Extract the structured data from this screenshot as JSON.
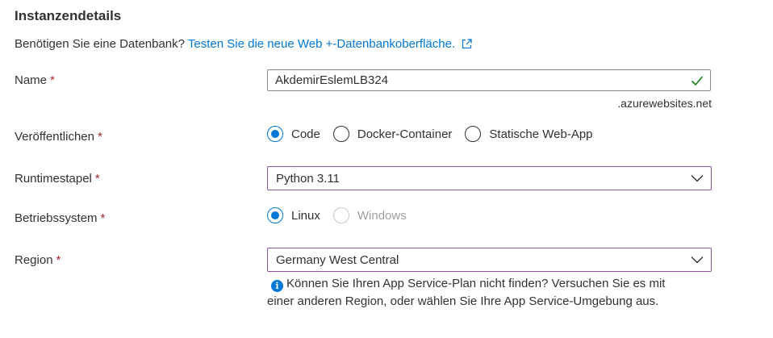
{
  "section": {
    "title": "Instanzendetails",
    "hint_text": "Benötigen Sie eine Datenbank?",
    "hint_link": "Testen Sie die neue Web +-Datenbankoberfläche.",
    "hint_link_icon": "external-link-icon"
  },
  "required_marker": "*",
  "name_field": {
    "label": "Name",
    "value": "AkdemirEslemLB324",
    "valid_icon": "checkmark-icon",
    "suffix": ".azurewebsites.net"
  },
  "publish": {
    "label": "Veröffentlichen",
    "options": [
      {
        "label": "Code",
        "selected": true
      },
      {
        "label": "Docker-Container",
        "selected": false
      },
      {
        "label": "Statische Web-App",
        "selected": false
      }
    ]
  },
  "runtime": {
    "label": "Runtimestapel",
    "value": "Python 3.11"
  },
  "os": {
    "label": "Betriebssystem",
    "options": [
      {
        "label": "Linux",
        "selected": true,
        "disabled": false
      },
      {
        "label": "Windows",
        "selected": false,
        "disabled": true
      }
    ]
  },
  "region": {
    "label": "Region",
    "value": "Germany West Central",
    "info_icon": "info-icon",
    "info_line1": "Können Sie Ihren App Service-Plan nicht finden? Versuchen Sie es mit",
    "info_line2": "einer anderen Region, oder wählen Sie Ihre App Service-Umgebung aus."
  },
  "colors": {
    "accent": "#0078d4",
    "required": "#a4262c",
    "valid": "#107c10",
    "dropdown_border": "#8a4e9c",
    "disabled": "#a19f9d"
  }
}
